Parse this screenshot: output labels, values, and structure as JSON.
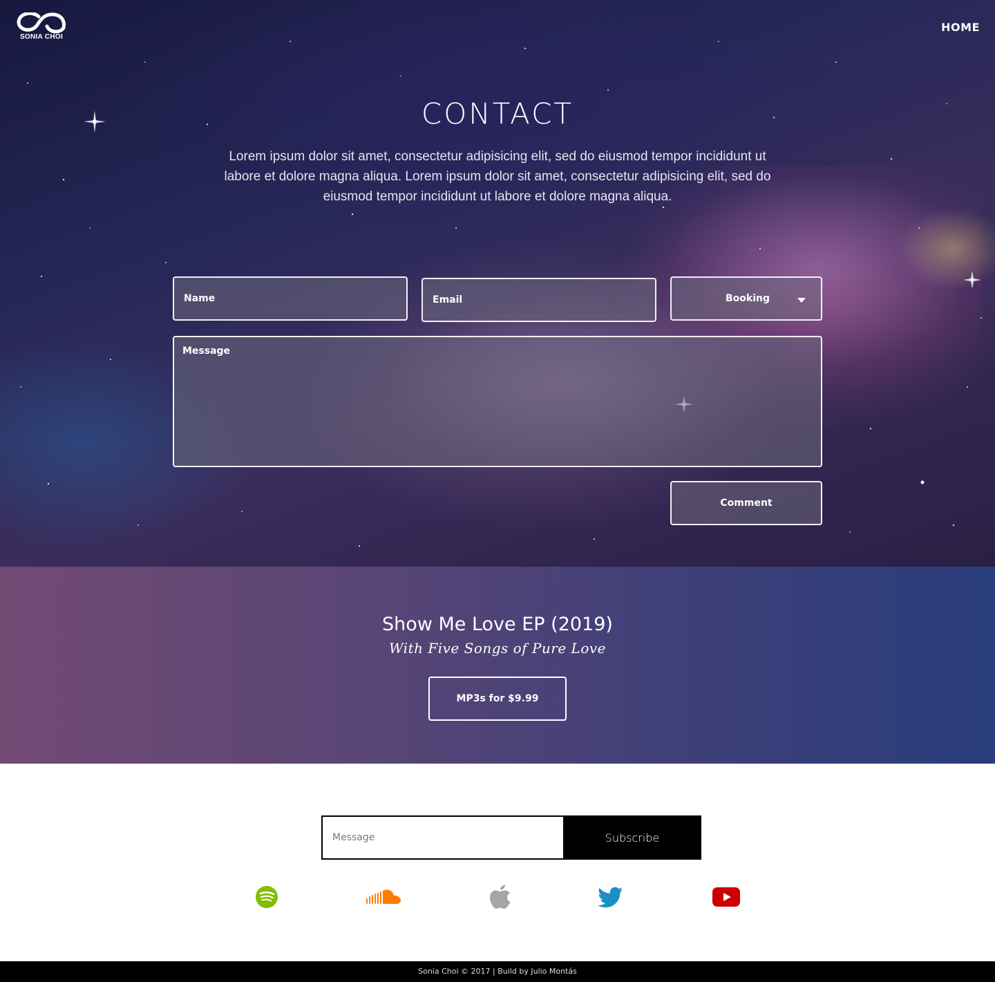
{
  "brand": {
    "logo_text": "SONIA CHOI"
  },
  "nav": {
    "home_label": "HOME"
  },
  "contact": {
    "title": "CONTACT",
    "description": "Lorem ipsum dolor sit amet, consectetur adipisicing elit, sed do eiusmod tempor incididunt ut labore et dolore magna aliqua. Lorem ipsum dolor sit amet, consectetur adipisicing elit, sed do eiusmod tempor incididunt ut labore et dolore magna aliqua.",
    "name_placeholder": "Name",
    "email_placeholder": "Email",
    "subject_selected": "Booking",
    "message_placeholder": "Message",
    "submit_label": "Comment"
  },
  "release": {
    "title": "Show Me Love EP (2019)",
    "subtitle": "With Five Songs of Pure Love",
    "buy_label": "MP3s for $9.99"
  },
  "subscribe": {
    "input_placeholder": "Message",
    "button_label": "Subscribe"
  },
  "social": [
    {
      "icon": "spotify-icon",
      "color": "#84bd00"
    },
    {
      "icon": "soundcloud-icon",
      "color": "#ff7a00"
    },
    {
      "icon": "apple-icon",
      "color": "#a6a6a6"
    },
    {
      "icon": "twitter-icon",
      "color": "#1d8fc7"
    },
    {
      "icon": "youtube-icon",
      "color": "#cc0000"
    }
  ],
  "footer": {
    "text": "Sonia Choi © 2017 | Build by Julio Montás"
  }
}
